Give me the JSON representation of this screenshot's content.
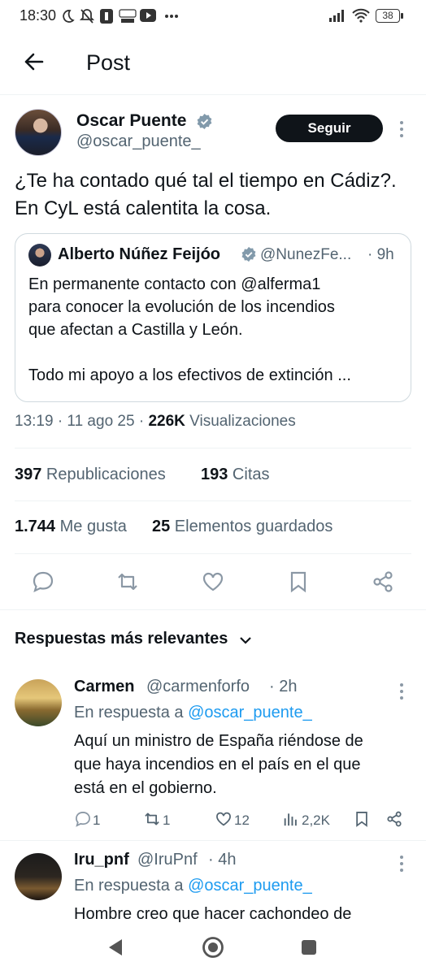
{
  "status_bar": {
    "time": "18:30",
    "battery": "38"
  },
  "header": {
    "title": "Post"
  },
  "post": {
    "author_name": "Oscar Puente",
    "author_handle": "@oscar_puente_",
    "follow_label": "Seguir",
    "text": "¿Te ha contado qué tal el tiempo en Cádiz?. En CyL está calentita la cosa.",
    "quote": {
      "name": "Alberto Núñez Feijóo",
      "handle": "@NunezFe...",
      "time": "· 9h",
      "text_line1": "En permanente contacto con @alferma1",
      "text_line2": "para conocer la evolución de los incendios",
      "text_line3": "que afectan a Castilla y León.",
      "text_line4": "Todo mi apoyo a los efectivos de extinción ..."
    },
    "timestamp": "13:19 · 11 ago 25 · ",
    "views_count": "226K",
    "views_label": " Visualizaciones",
    "reposts_count": "397",
    "reposts_label": " Republicaciones",
    "quotes_count": "193",
    "quotes_label": " Citas",
    "likes_count": "1.744",
    "likes_label": " Me gusta",
    "bookmarks_count": "25",
    "bookmarks_label": " Elementos guardados"
  },
  "replies_header": "Respuestas más relevantes",
  "replies": [
    {
      "name": "Carmen",
      "handle": "@carmenforfo",
      "time": "· 2h",
      "in_reply_prefix": "En respuesta a ",
      "in_reply_to": "@oscar_puente_",
      "text_line1": "Aquí un ministro de España riéndose de",
      "text_line2": "que haya incendios en el país en el que",
      "text_line3": "está en el gobierno.",
      "replies": "1",
      "reposts": "1",
      "likes": "12",
      "views": "2,2K"
    },
    {
      "name": "Iru_pnf",
      "handle": "@IruPnf",
      "time": "· 4h",
      "in_reply_prefix": "En respuesta a ",
      "in_reply_to": "@oscar_puente_",
      "text_line1": "Hombre creo que hacer cachondeo de"
    }
  ],
  "colors": {
    "accent": "#1d9bf0",
    "text": "#0f1419",
    "muted": "#536471",
    "button_bg": "#0f1419"
  }
}
